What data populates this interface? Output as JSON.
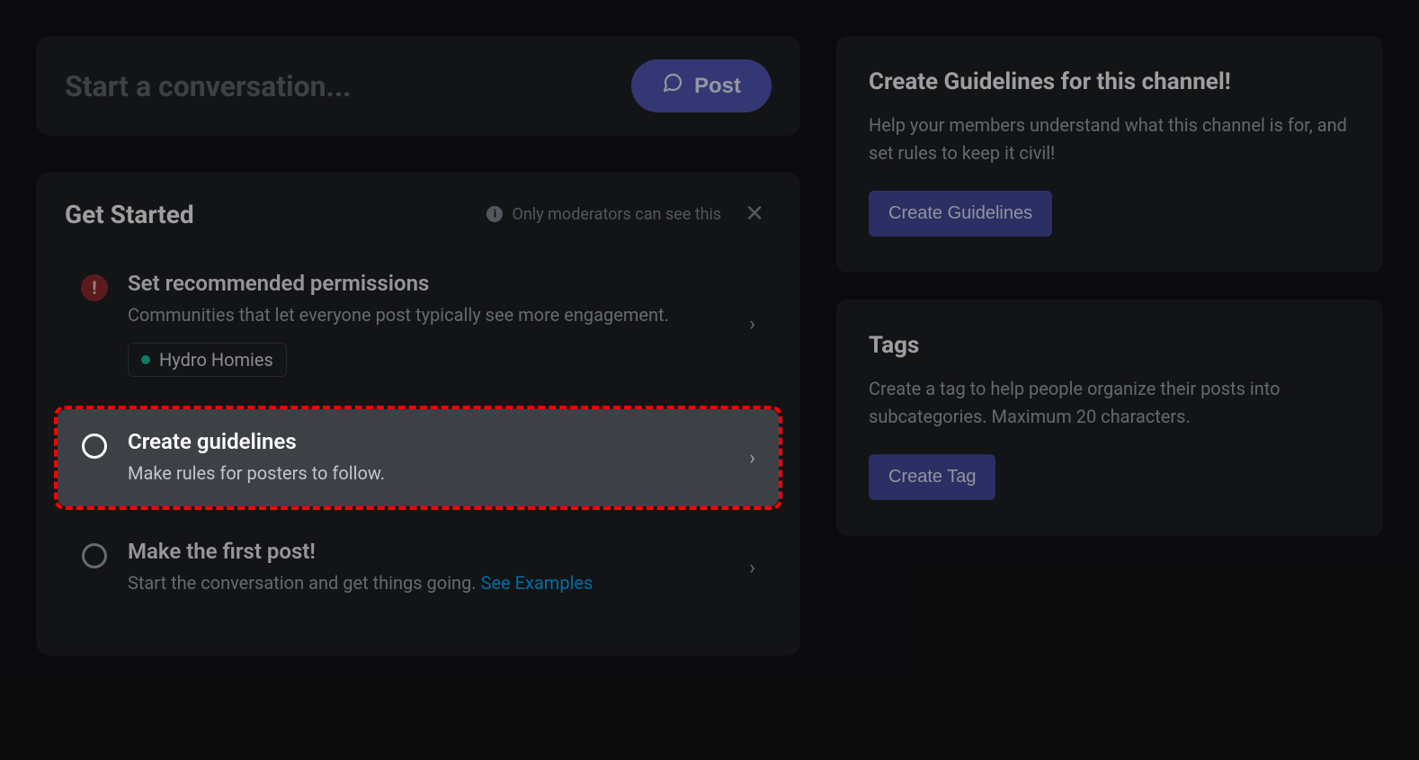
{
  "start_card": {
    "placeholder": "Start a conversation...",
    "post_label": "Post"
  },
  "get_started": {
    "title": "Get Started",
    "mod_note": "Only moderators can see this",
    "items": {
      "permissions": {
        "title": "Set recommended permissions",
        "desc": "Communities that let everyone post typically see more engagement.",
        "role_chip": "Hydro Homies"
      },
      "guidelines": {
        "title": "Create guidelines",
        "desc": "Make rules for posters to follow."
      },
      "first_post": {
        "title": "Make the first post!",
        "desc": "Start the conversation and get things going. ",
        "link": "See Examples"
      }
    }
  },
  "side": {
    "guidelines": {
      "title": "Create Guidelines for this channel!",
      "desc": "Help your members understand what this channel is for, and set rules to keep it civil!",
      "button": "Create Guidelines"
    },
    "tags": {
      "title": "Tags",
      "desc": "Create a tag to help people organize their posts into subcategories. Maximum 20 characters.",
      "button": "Create Tag"
    }
  }
}
